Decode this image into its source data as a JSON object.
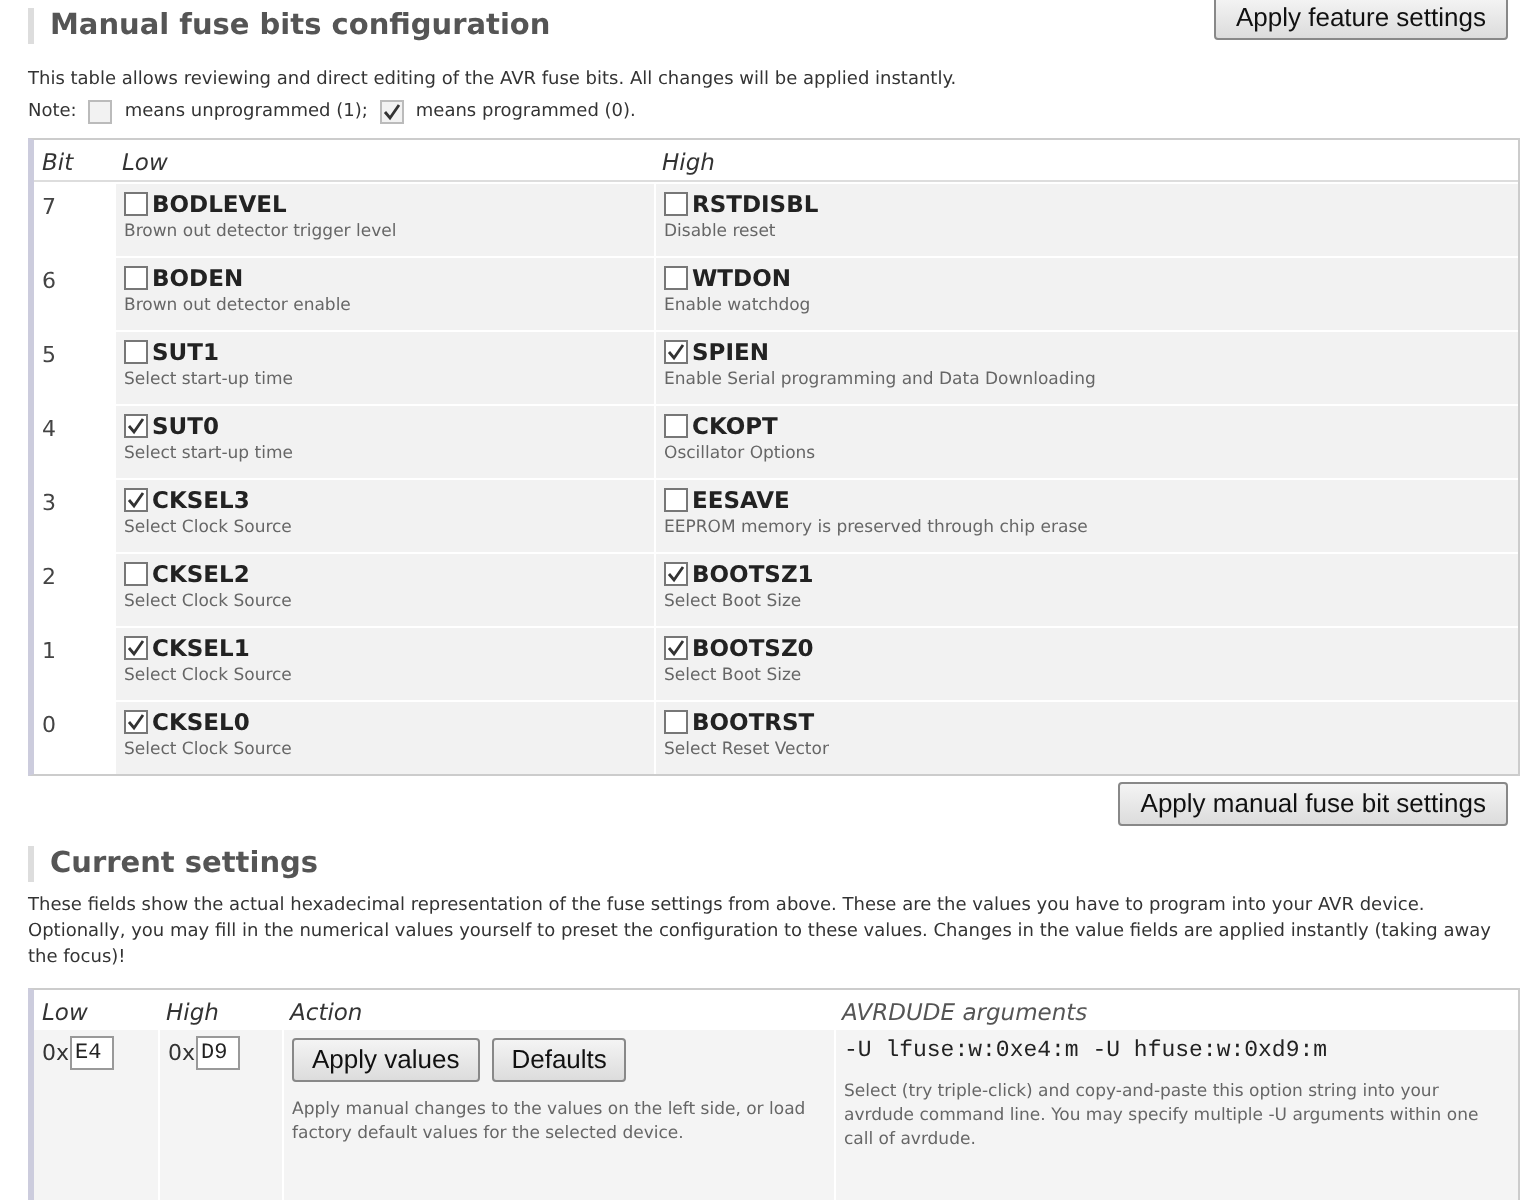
{
  "feature_button": "Apply feature settings",
  "manual": {
    "title": "Manual fuse bits configuration",
    "intro": "This table allows reviewing and direct editing of the AVR fuse bits. All changes will be applied instantly.",
    "note_label": "Note:",
    "legend": [
      {
        "checked": false,
        "text": "means unprogrammed (1);"
      },
      {
        "checked": true,
        "text": "means programmed (0)."
      }
    ],
    "columns": [
      "Bit",
      "Low",
      "High"
    ],
    "rows": [
      {
        "bit": "7",
        "low": {
          "name": "BODLEVEL",
          "description": "Brown out detector trigger level",
          "checked": false
        },
        "high": {
          "name": "RSTDISBL",
          "description": "Disable reset",
          "checked": false
        }
      },
      {
        "bit": "6",
        "low": {
          "name": "BODEN",
          "description": "Brown out detector enable",
          "checked": false
        },
        "high": {
          "name": "WTDON",
          "description": "Enable watchdog",
          "checked": false
        }
      },
      {
        "bit": "5",
        "low": {
          "name": "SUT1",
          "description": "Select start-up time",
          "checked": false
        },
        "high": {
          "name": "SPIEN",
          "description": "Enable Serial programming and Data Downloading",
          "checked": true
        }
      },
      {
        "bit": "4",
        "low": {
          "name": "SUT0",
          "description": "Select start-up time",
          "checked": true
        },
        "high": {
          "name": "CKOPT",
          "description": "Oscillator Options",
          "checked": false
        }
      },
      {
        "bit": "3",
        "low": {
          "name": "CKSEL3",
          "description": "Select Clock Source",
          "checked": true
        },
        "high": {
          "name": "EESAVE",
          "description": "EEPROM memory is preserved through chip erase",
          "checked": false
        }
      },
      {
        "bit": "2",
        "low": {
          "name": "CKSEL2",
          "description": "Select Clock Source",
          "checked": false
        },
        "high": {
          "name": "BOOTSZ1",
          "description": "Select Boot Size",
          "checked": true
        }
      },
      {
        "bit": "1",
        "low": {
          "name": "CKSEL1",
          "description": "Select Clock Source",
          "checked": true
        },
        "high": {
          "name": "BOOTSZ0",
          "description": "Select Boot Size",
          "checked": true
        }
      },
      {
        "bit": "0",
        "low": {
          "name": "CKSEL0",
          "description": "Select Clock Source",
          "checked": true
        },
        "high": {
          "name": "BOOTRST",
          "description": "Select Reset Vector",
          "checked": false
        }
      }
    ],
    "apply_button": "Apply manual fuse bit settings"
  },
  "current": {
    "title": "Current settings",
    "intro": "These fields show the actual hexadecimal representation of the fuse settings from above. These are the values you have to program into your AVR device. Optionally, you may fill in the numerical values yourself to preset the configuration to these values. Changes in the value fields are applied instantly (taking away the focus)!",
    "columns": [
      "Low",
      "High",
      "Action",
      "*AVRDUDE* arguments"
    ],
    "fuses": [
      {
        "prefix": "0x",
        "value": "E4"
      },
      {
        "prefix": "0x",
        "value": "D9"
      }
    ],
    "buttons": [
      "Apply values",
      "Defaults"
    ],
    "action_note": "Apply manual changes to the values on the left side, or load factory default values for the selected device.",
    "avrdude_args": "-U lfuse:w:0xe4:m -U hfuse:w:0xd9:m",
    "avrdude_note": "Select (try triple-click) and copy-and-paste this option string into your avrdude command line. You may specify multiple -U arguments within one call of avrdude."
  }
}
